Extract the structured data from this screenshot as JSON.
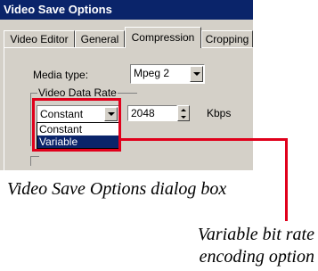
{
  "dialog": {
    "title": "Video Save Options",
    "tabs": [
      {
        "label": "Video Editor",
        "active": false
      },
      {
        "label": "General",
        "active": false
      },
      {
        "label": "Compression",
        "active": true
      },
      {
        "label": "Cropping",
        "active": false
      }
    ],
    "media_type": {
      "label": "Media type:",
      "value": "Mpeg 2"
    },
    "video_data_rate": {
      "group_label": "Video Data Rate",
      "mode_value": "Constant",
      "mode_options": [
        "Constant",
        "Variable"
      ],
      "selected_option": "Variable",
      "rate_value": "2048",
      "rate_unit": "Kbps"
    }
  },
  "captions": {
    "dialog_caption": "Video Save Options dialog box",
    "option_caption_line1": "Variable bit rate",
    "option_caption_line2": "encoding option"
  },
  "colors": {
    "titlebar": "#0a246a",
    "dialog_face": "#d4d0c8",
    "highlight": "#e0001b",
    "selection": "#0a246a"
  }
}
